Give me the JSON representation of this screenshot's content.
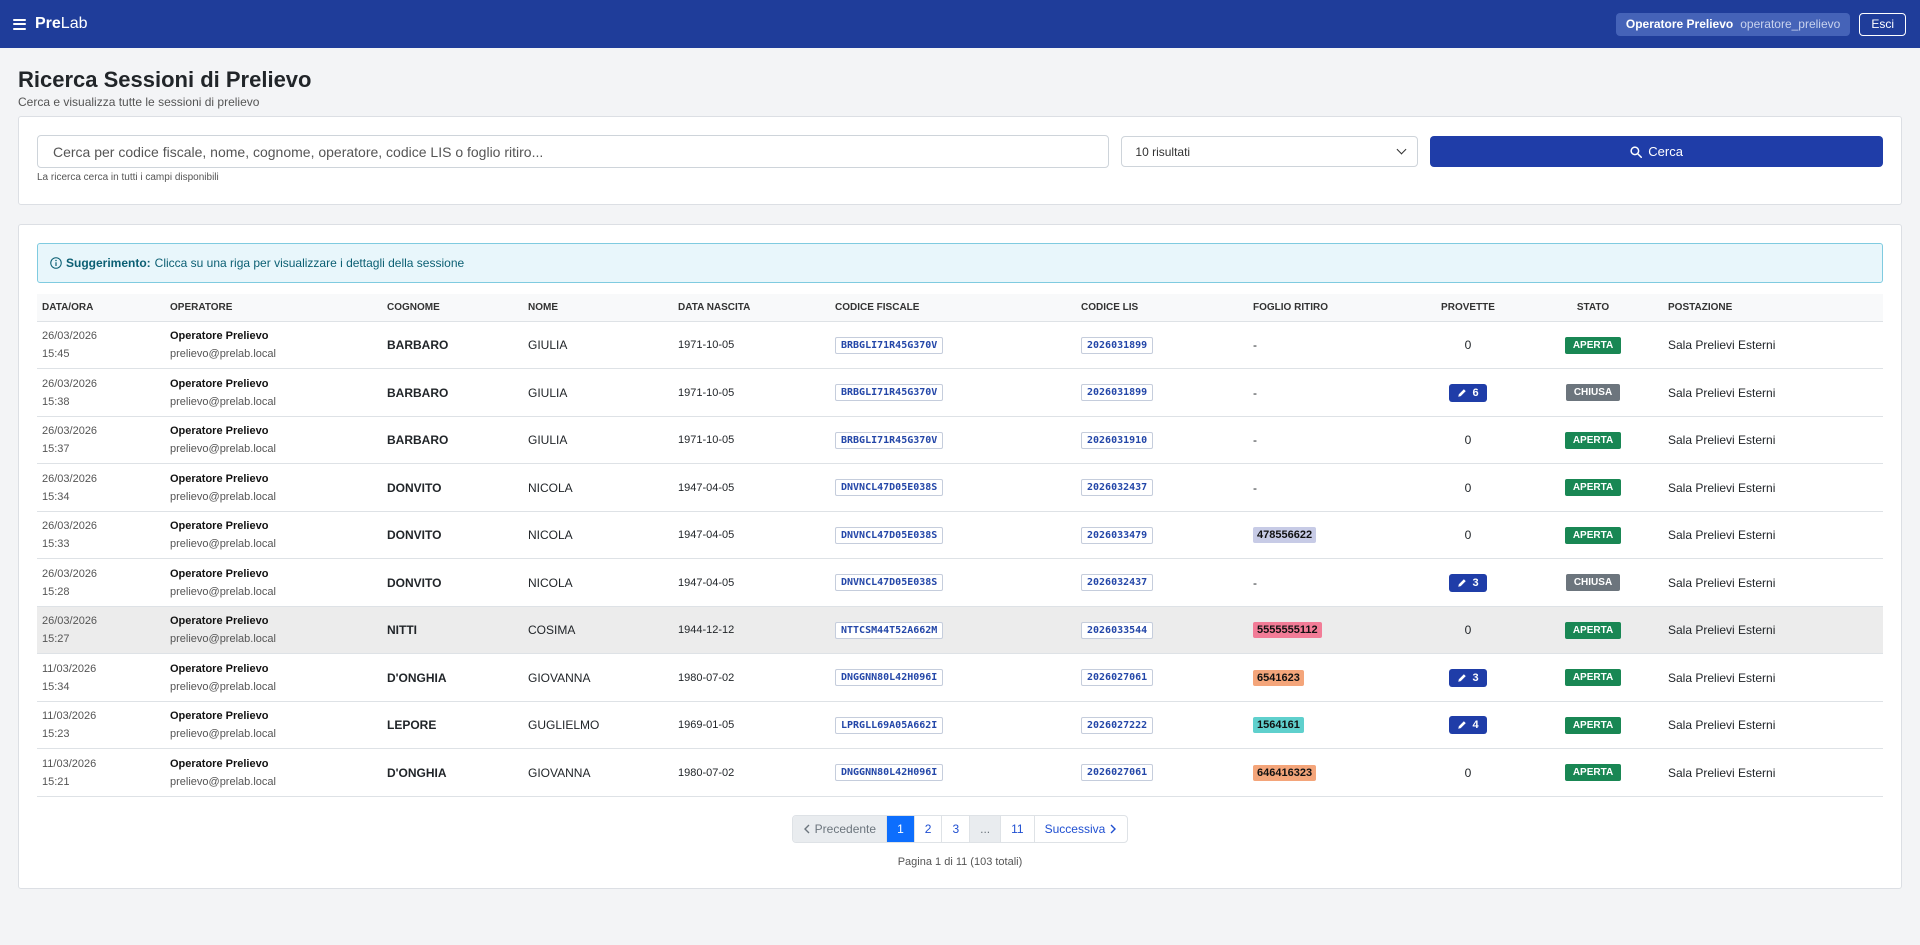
{
  "nav": {
    "brand_bold": "Pre",
    "brand_rest": "Lab",
    "user_name": "Operatore Prelievo",
    "user_login": "operatore_prelievo",
    "logout_label": "Esci"
  },
  "header": {
    "title": "Ricerca Sessioni di Prelievo",
    "subtitle": "Cerca e visualizza tutte le sessioni di prelievo"
  },
  "search": {
    "placeholder": "Cerca per codice fiscale, nome, cognome, operatore, codice LIS o foglio ritiro...",
    "value": "",
    "results_select": "10 risultati",
    "button_label": "Cerca",
    "hint": "La ricerca cerca in tutti i campi disponibili"
  },
  "alert": {
    "label": "Suggerimento:",
    "text": "Clicca su una riga per visualizzare i dettagli della sessione"
  },
  "columns": [
    "DATA/ORA",
    "OPERATORE",
    "COGNOME",
    "NOME",
    "DATA NASCITA",
    "CODICE FISCALE",
    "CODICE LIS",
    "FOGLIO RITIRO",
    "PROVETTE",
    "STATO",
    "POSTAZIONE"
  ],
  "rows": [
    {
      "date": "26/03/2026",
      "time": "15:45",
      "op": "Operatore Prelievo",
      "mail": "prelievo@prelab.local",
      "cognome": "BARBARO",
      "nome": "GIULIA",
      "nascita": "1971-10-05",
      "cf": "BRBGLI71R45G370V",
      "lis": "2026031899",
      "foglio": "-",
      "foglio_color": "",
      "provette": "0",
      "provette_badge": false,
      "stato": "APERTA",
      "postazione": "Sala Prelievi Esterni"
    },
    {
      "date": "26/03/2026",
      "time": "15:38",
      "op": "Operatore Prelievo",
      "mail": "prelievo@prelab.local",
      "cognome": "BARBARO",
      "nome": "GIULIA",
      "nascita": "1971-10-05",
      "cf": "BRBGLI71R45G370V",
      "lis": "2026031899",
      "foglio": "-",
      "foglio_color": "",
      "provette": "6",
      "provette_badge": true,
      "stato": "CHIUSA",
      "postazione": "Sala Prelievi Esterni"
    },
    {
      "date": "26/03/2026",
      "time": "15:37",
      "op": "Operatore Prelievo",
      "mail": "prelievo@prelab.local",
      "cognome": "BARBARO",
      "nome": "GIULIA",
      "nascita": "1971-10-05",
      "cf": "BRBGLI71R45G370V",
      "lis": "2026031910",
      "foglio": "-",
      "foglio_color": "",
      "provette": "0",
      "provette_badge": false,
      "stato": "APERTA",
      "postazione": "Sala Prelievi Esterni"
    },
    {
      "date": "26/03/2026",
      "time": "15:34",
      "op": "Operatore Prelievo",
      "mail": "prelievo@prelab.local",
      "cognome": "DONVITO",
      "nome": "NICOLA",
      "nascita": "1947-04-05",
      "cf": "DNVNCL47D05E038S",
      "lis": "2026032437",
      "foglio": "-",
      "foglio_color": "",
      "provette": "0",
      "provette_badge": false,
      "stato": "APERTA",
      "postazione": "Sala Prelievi Esterni"
    },
    {
      "date": "26/03/2026",
      "time": "15:33",
      "op": "Operatore Prelievo",
      "mail": "prelievo@prelab.local",
      "cognome": "DONVITO",
      "nome": "NICOLA",
      "nascita": "1947-04-05",
      "cf": "DNVNCL47D05E038S",
      "lis": "2026033479",
      "foglio": "478556622",
      "foglio_color": "#c7cbe6",
      "provette": "0",
      "provette_badge": false,
      "stato": "APERTA",
      "postazione": "Sala Prelievi Esterni"
    },
    {
      "date": "26/03/2026",
      "time": "15:28",
      "op": "Operatore Prelievo",
      "mail": "prelievo@prelab.local",
      "cognome": "DONVITO",
      "nome": "NICOLA",
      "nascita": "1947-04-05",
      "cf": "DNVNCL47D05E038S",
      "lis": "2026032437",
      "foglio": "-",
      "foglio_color": "",
      "provette": "3",
      "provette_badge": true,
      "stato": "CHIUSA",
      "postazione": "Sala Prelievi Esterni"
    },
    {
      "date": "26/03/2026",
      "time": "15:27",
      "op": "Operatore Prelievo",
      "mail": "prelievo@prelab.local",
      "cognome": "NITTI",
      "nome": "COSIMA",
      "nascita": "1944-12-12",
      "cf": "NTTCSM44T52A662M",
      "lis": "2026033544",
      "foglio": "5555555112",
      "foglio_color": "#f27c97",
      "provette": "0",
      "provette_badge": false,
      "stato": "APERTA",
      "postazione": "Sala Prelievi Esterni",
      "highlight": true
    },
    {
      "date": "11/03/2026",
      "time": "15:34",
      "op": "Operatore Prelievo",
      "mail": "prelievo@prelab.local",
      "cognome": "D'ONGHIA",
      "nome": "GIOVANNA",
      "nascita": "1980-07-02",
      "cf": "DNGGNN80L42H096I",
      "lis": "2026027061",
      "foglio": "6541623",
      "foglio_color": "#f4a57a",
      "provette": "3",
      "provette_badge": true,
      "stato": "APERTA",
      "postazione": "Sala Prelievi Esterni"
    },
    {
      "date": "11/03/2026",
      "time": "15:23",
      "op": "Operatore Prelievo",
      "mail": "prelievo@prelab.local",
      "cognome": "LEPORE",
      "nome": "GUGLIELMO",
      "nascita": "1969-01-05",
      "cf": "LPRGLL69A05A662I",
      "lis": "2026027222",
      "foglio": "1564161",
      "foglio_color": "#5fd0cd",
      "provette": "4",
      "provette_badge": true,
      "stato": "APERTA",
      "postazione": "Sala Prelievi Esterni"
    },
    {
      "date": "11/03/2026",
      "time": "15:21",
      "op": "Operatore Prelievo",
      "mail": "prelievo@prelab.local",
      "cognome": "D'ONGHIA",
      "nome": "GIOVANNA",
      "nascita": "1980-07-02",
      "cf": "DNGGNN80L42H096I",
      "lis": "2026027061",
      "foglio": "646416323",
      "foglio_color": "#f4a57a",
      "provette": "0",
      "provette_badge": false,
      "stato": "APERTA",
      "postazione": "Sala Prelievi Esterni"
    }
  ],
  "stato_colors": {
    "APERTA": "#198754",
    "CHIUSA": "#6c757d"
  },
  "pagination": {
    "prev": "Precedente",
    "next": "Successiva",
    "pages": [
      "1",
      "2",
      "3",
      "...",
      "11"
    ],
    "current": "1",
    "info": "Pagina 1 di 11 (103 totali)"
  }
}
